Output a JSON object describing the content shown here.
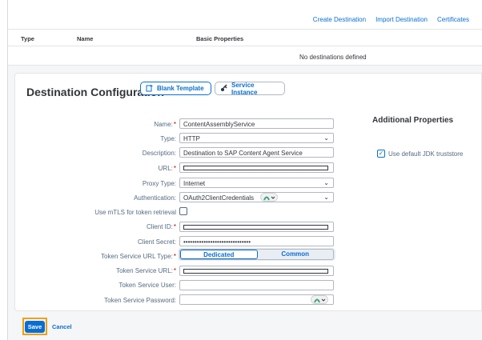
{
  "toolbar": {
    "create_destination": "Create Destination",
    "import_destination": "Import Destination",
    "certificates": "Certificates"
  },
  "table": {
    "columns": [
      "Type",
      "Name",
      "Basic Properties"
    ],
    "empty_text": "No destinations defined"
  },
  "config": {
    "title": "Destination Configuration",
    "blank_template_label": "Blank Template",
    "service_instance_label": "Service Instance",
    "fields": {
      "name": {
        "label": "Name:",
        "value": "ContentAssemblyService"
      },
      "type": {
        "label": "Type:",
        "value": "HTTP"
      },
      "description": {
        "label": "Description:",
        "value": "Destination to SAP Content Agent Service"
      },
      "url": {
        "label": "URL:"
      },
      "proxy_type": {
        "label": "Proxy Type:",
        "value": "Internet"
      },
      "authentication": {
        "label": "Authentication:",
        "value": "OAuth2ClientCredentials"
      },
      "mtls": {
        "label": "Use mTLS for token retrieval"
      },
      "client_id": {
        "label": "Client ID:"
      },
      "client_secret": {
        "label": "Client Secret:",
        "value": "••••••••••••••••••••••••••••••"
      },
      "token_service_url_type": {
        "label": "Token Service URL Type:",
        "options": [
          "Dedicated",
          "Common"
        ]
      },
      "token_service_url": {
        "label": "Token Service URL:"
      },
      "token_service_user": {
        "label": "Token Service User:"
      },
      "token_service_password": {
        "label": "Token Service Password:"
      }
    },
    "required_mark": "*",
    "additional_properties": {
      "title": "Additional Properties",
      "use_default_jdk_label": "Use default JDK truststore",
      "use_default_jdk_checked": true
    }
  },
  "footer": {
    "save_label": "Save",
    "cancel_label": "Cancel"
  },
  "colors": {
    "accent": "#0a6ed1",
    "required": "#bb0000",
    "save_highlight": "#f0a000"
  }
}
